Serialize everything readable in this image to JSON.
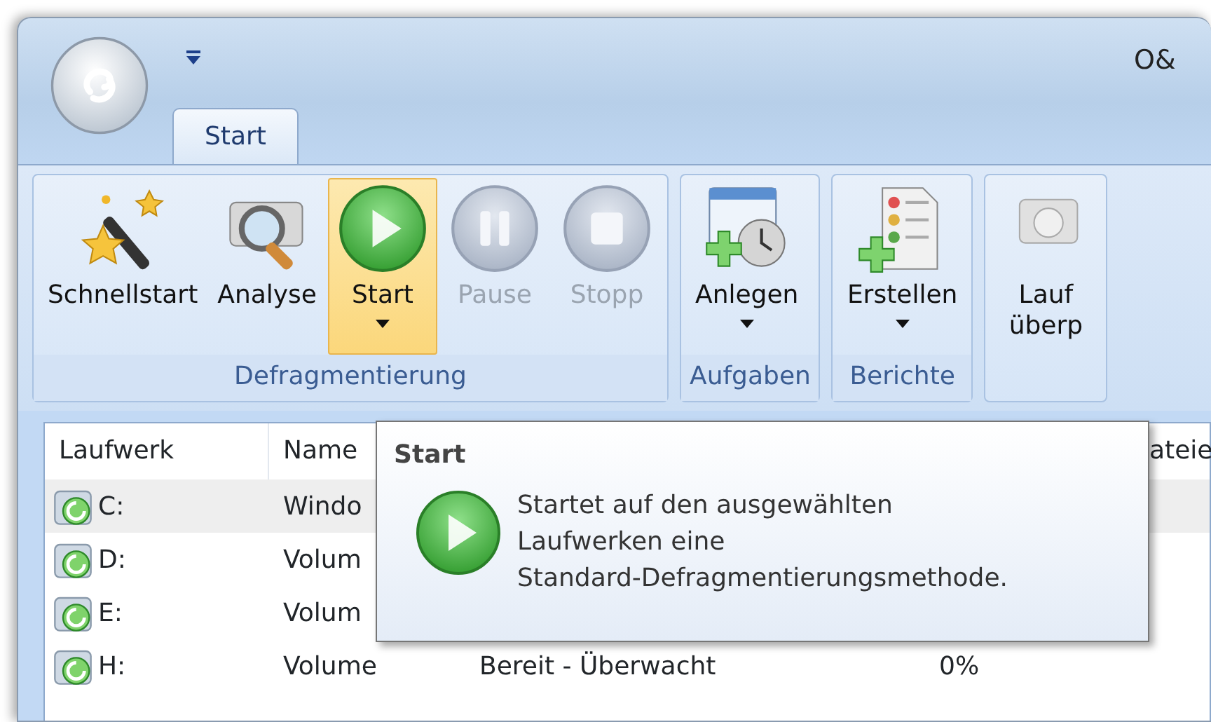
{
  "window": {
    "title": "O&"
  },
  "tabs": [
    {
      "label": "Start",
      "selected": true
    }
  ],
  "ribbon": {
    "groups": [
      {
        "label": "Defragmentierung",
        "buttons": [
          {
            "label": "Schnellstart",
            "kind": "wand",
            "disabled": false,
            "highlighted": false,
            "dropdown": false
          },
          {
            "label": "Analyse",
            "kind": "analyze",
            "disabled": false,
            "highlighted": false,
            "dropdown": false
          },
          {
            "label": "Start",
            "kind": "play",
            "disabled": false,
            "highlighted": true,
            "dropdown": true
          },
          {
            "label": "Pause",
            "kind": "pause",
            "disabled": true,
            "highlighted": false,
            "dropdown": false
          },
          {
            "label": "Stopp",
            "kind": "stop",
            "disabled": true,
            "highlighted": false,
            "dropdown": false
          }
        ]
      },
      {
        "label": "Aufgaben",
        "buttons": [
          {
            "label": "Anlegen",
            "kind": "schedule",
            "disabled": false,
            "highlighted": false,
            "dropdown": true
          }
        ]
      },
      {
        "label": "Berichte",
        "buttons": [
          {
            "label": "Erstellen",
            "kind": "report",
            "disabled": false,
            "highlighted": false,
            "dropdown": true
          }
        ]
      },
      {
        "buttons": [
          {
            "label_lines": [
              "Lauf",
              "überp"
            ],
            "kind": "check",
            "disabled": false,
            "highlighted": false,
            "dropdown": false
          }
        ]
      }
    ]
  },
  "table": {
    "columns": [
      {
        "label": "Laufwerk"
      },
      {
        "label": "Name"
      },
      {},
      {},
      {
        "label": "ateie"
      }
    ],
    "rows": [
      {
        "cells": [
          "C:",
          "Windo"
        ],
        "selected": true
      },
      {
        "cells": [
          "D:",
          "Volum"
        ],
        "selected": false
      },
      {
        "cells": [
          "E:",
          "Volum"
        ],
        "selected": false
      },
      {
        "cells": [
          "H:",
          "Volume",
          "Bereit - Überwacht",
          "0%"
        ],
        "selected": false
      }
    ]
  },
  "tooltip": {
    "title": "Start",
    "lines": [
      "Startet auf den ausgewählten",
      "Laufwerken eine",
      "Standard-Defragmentierungsmethode."
    ]
  }
}
